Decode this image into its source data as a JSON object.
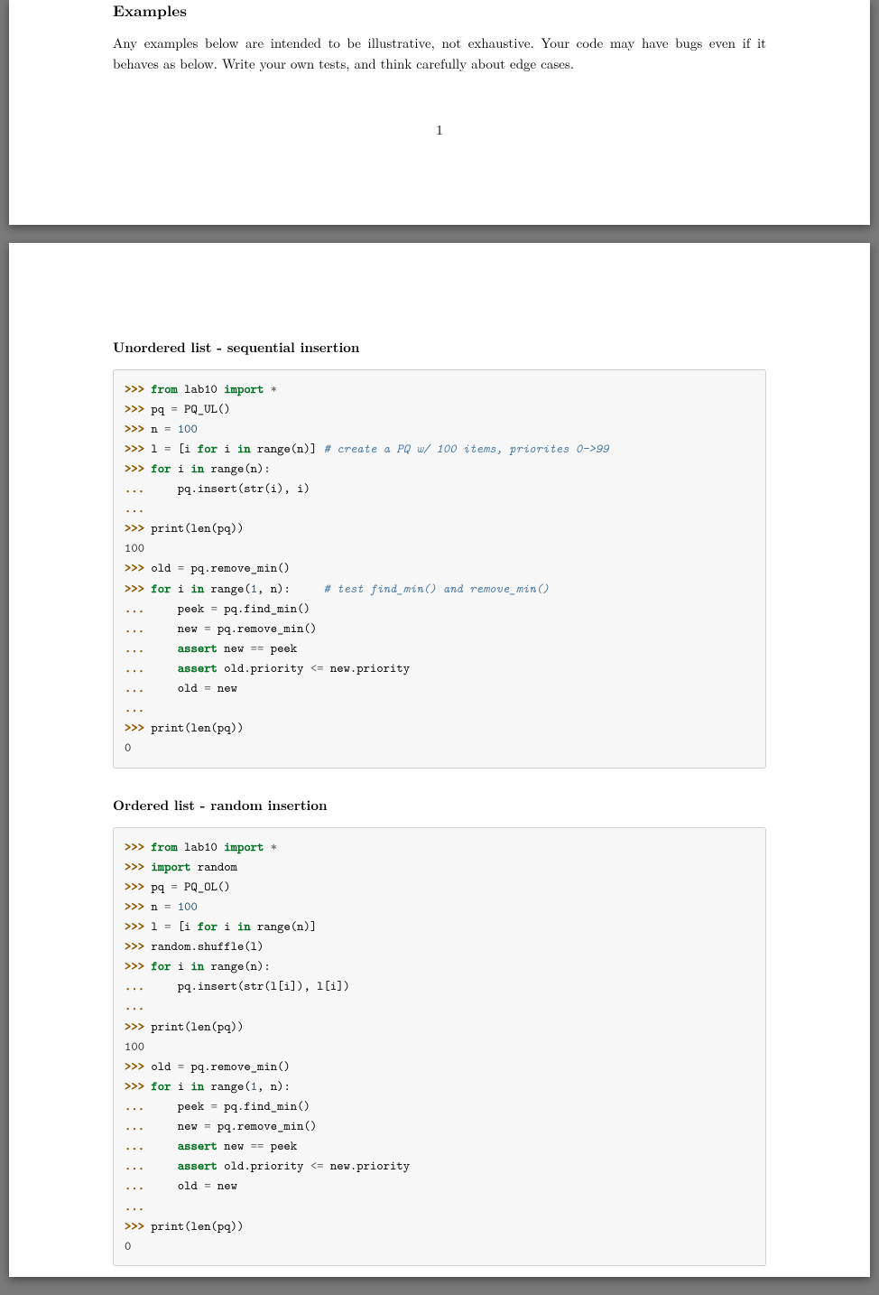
{
  "page1": {
    "heading": "Examples",
    "paragraph": "Any examples below are intended to be illustrative, not exhaustive. Your code may have bugs even if it behaves as below. Write your own tests, and think carefully about edge cases.",
    "pageNumber": "1"
  },
  "page2": {
    "sub1": "Unordered list - sequential insertion",
    "sub2": "Ordered list - random insertion",
    "code1": {
      "l1_from": "from",
      "l1_mod": " lab10 ",
      "l1_import": "import",
      "l1_star": " *",
      "l2_pq": "pq ",
      "l2_eq": "=",
      "l2_call": " PQ_UL()",
      "l3_n": "n ",
      "l3_eq": "=",
      "l3_sp": " ",
      "l3_num": "100",
      "l4_l": "l ",
      "l4_eq": "=",
      "l4_sp": " [i ",
      "l4_for": "for",
      "l4_i": " i ",
      "l4_in": "in",
      "l4_rng": " range(n)] ",
      "l4_cm": "# create a PQ w/ 100 items, priorites 0->99",
      "l5_for": "for",
      "l5_i": " i ",
      "l5_in": "in",
      "l5_rng": " range(n):",
      "l6_body": "     pq.insert(str(i), i)",
      "l7_empty": "",
      "l8_print": "print(len(pq))",
      "l9_out": "100",
      "l10_var": "old ",
      "l10_eq": "=",
      "l10_call": " pq.remove_min()",
      "l11_for": "for",
      "l11_i": " i ",
      "l11_in": "in",
      "l11_rng": " range(",
      "l11_n1": "1",
      "l11_tail": ", n):     ",
      "l11_cm": "# test find_min() and remove_min()",
      "l12_var": "     peek ",
      "l12_eq": "=",
      "l12_call": " pq.find_min()",
      "l13_var": "     new ",
      "l13_eq": "=",
      "l13_call": " pq.remove_min()",
      "l14_ind": "     ",
      "l14_assert": "assert",
      "l14_sp": " new ",
      "l14_op": "==",
      "l14_rest": " peek",
      "l15_ind": "     ",
      "l15_assert": "assert",
      "l15_sp": " old.priority ",
      "l15_op": "<=",
      "l15_rest": " new.priority",
      "l16_var": "     old ",
      "l16_eq": "=",
      "l16_rest": " new",
      "l17_empty": "",
      "l18_print": "print(len(pq))",
      "l19_out": "0"
    },
    "code2": {
      "l1_from": "from",
      "l1_mod": " lab10 ",
      "l1_import": "import",
      "l1_star": " *",
      "l2_import": "import",
      "l2_mod": " random",
      "l3_pq": "pq ",
      "l3_eq": "=",
      "l3_call": " PQ_OL()",
      "l4_n": "n ",
      "l4_eq": "=",
      "l4_sp": " ",
      "l4_num": "100",
      "l5_l": "l ",
      "l5_eq": "=",
      "l5_sp": " [i ",
      "l5_for": "for",
      "l5_i": " i ",
      "l5_in": "in",
      "l5_rng": " range(n)]",
      "l6_call": "random.shuffle(l)",
      "l7_for": "for",
      "l7_i": " i ",
      "l7_in": "in",
      "l7_rng": " range(n):",
      "l8_body": "     pq.insert(str(l[i]), l[i])",
      "l9_empty": "",
      "l10_print": "print(len(pq))",
      "l11_out": "100",
      "l12_var": "old ",
      "l12_eq": "=",
      "l12_call": " pq.remove_min()",
      "l13_for": "for",
      "l13_i": " i ",
      "l13_in": "in",
      "l13_rng": " range(",
      "l13_n1": "1",
      "l13_tail": ", n):",
      "l14_var": "     peek ",
      "l14_eq": "=",
      "l14_call": " pq.find_min()",
      "l15_var": "     new ",
      "l15_eq": "=",
      "l15_call": " pq.remove_min()",
      "l16_ind": "     ",
      "l16_assert": "assert",
      "l16_sp": " new ",
      "l16_op": "==",
      "l16_rest": " peek",
      "l17_ind": "     ",
      "l17_assert": "assert",
      "l17_sp": " old.priority ",
      "l17_op": "<=",
      "l17_rest": " new.priority",
      "l18_var": "     old ",
      "l18_eq": "=",
      "l18_rest": " new",
      "l19_empty": "",
      "l20_print": "print(len(pq))",
      "l21_out": "0"
    },
    "prompt": ">>> ",
    "cont": "..."
  }
}
